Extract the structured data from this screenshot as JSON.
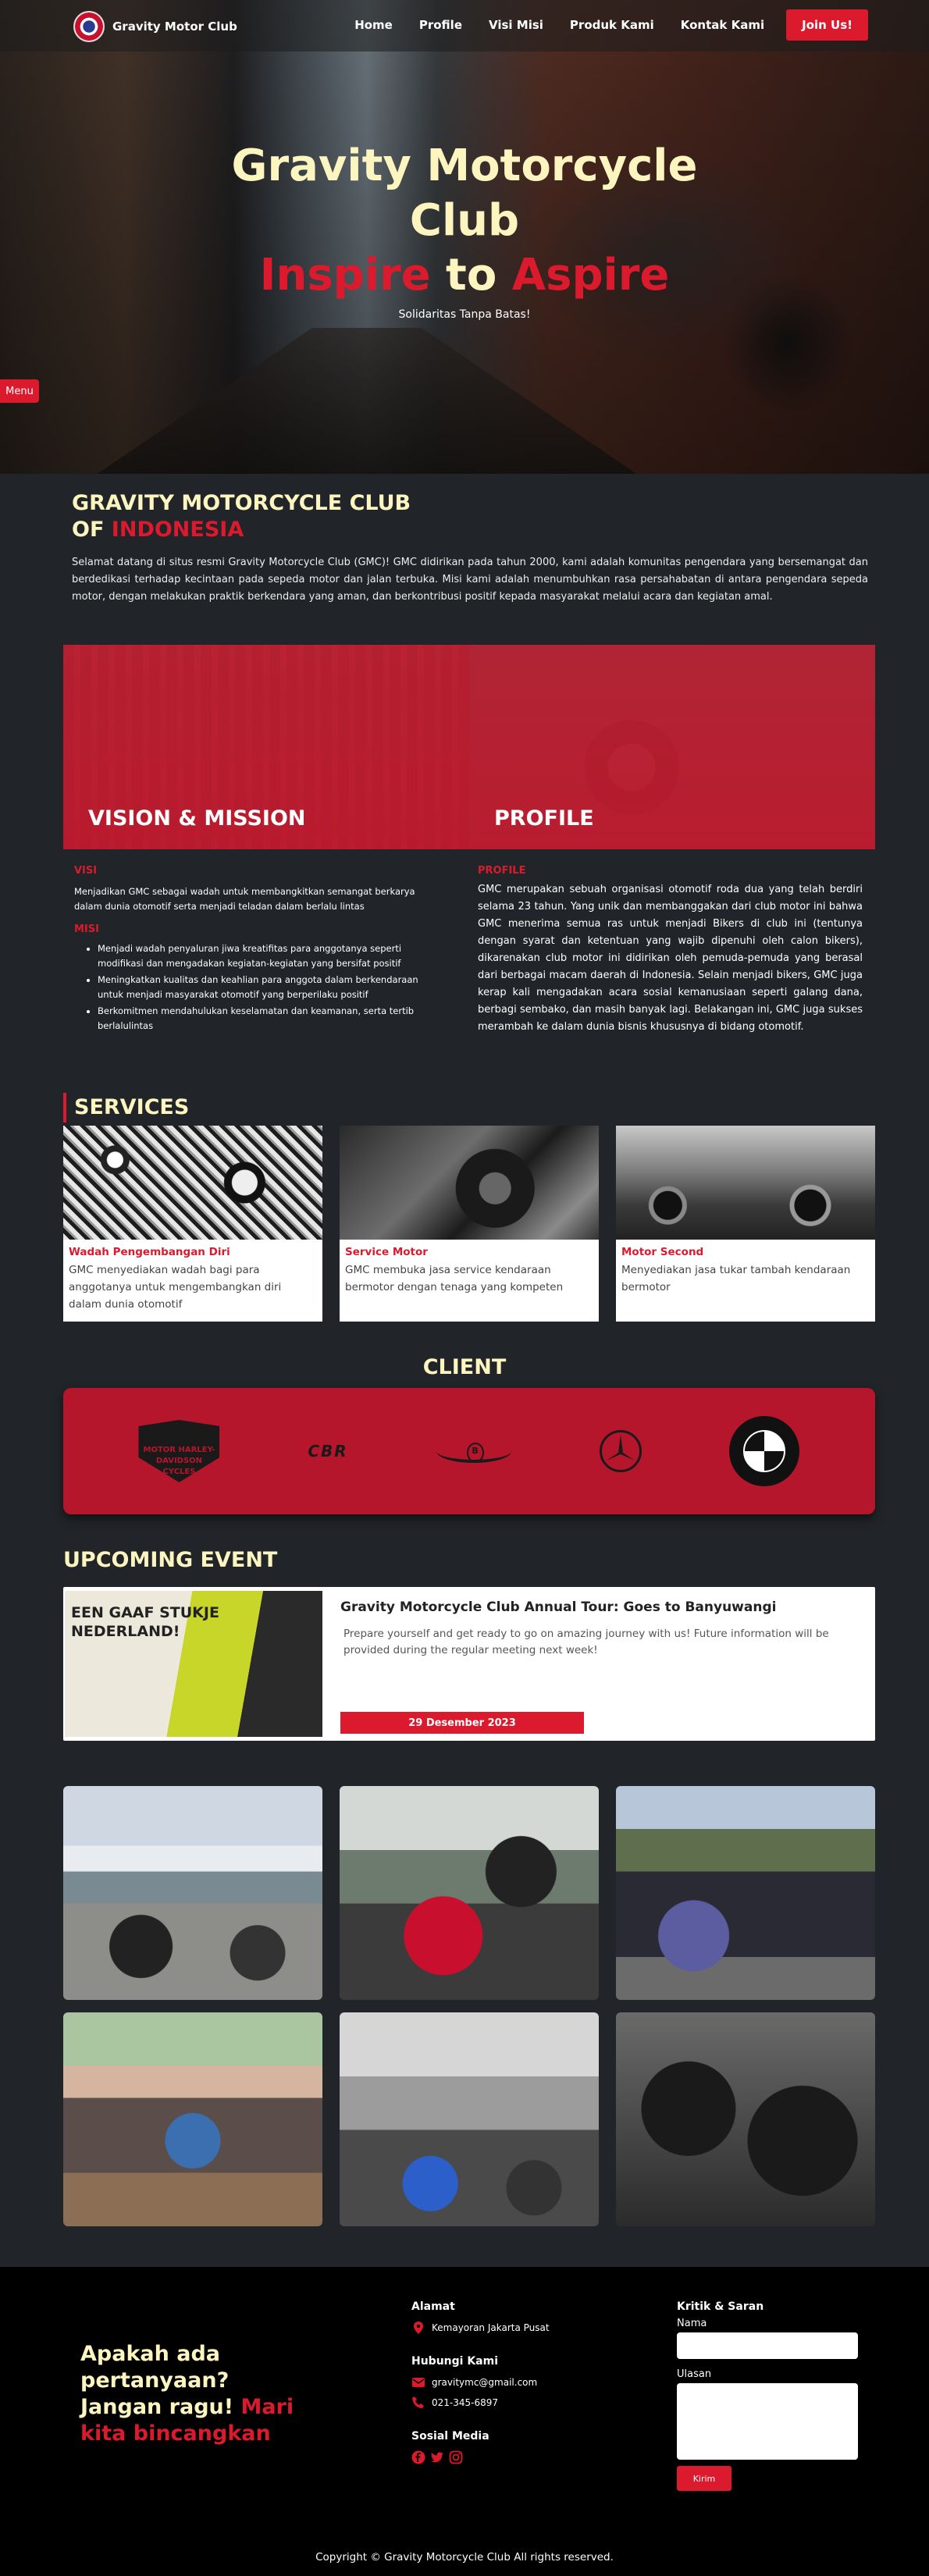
{
  "nav": {
    "brand": "Gravity Motor Club",
    "links": [
      "Home",
      "Profile",
      "Visi Misi",
      "Produk Kami",
      "Kontak Kami"
    ],
    "join": "Join Us!"
  },
  "hero": {
    "title_line1": "Gravity Motorcycle",
    "title_line2": "Club",
    "inspire": "Inspire",
    "to": " to ",
    "aspire": "Aspire",
    "subtitle": "Solidaritas Tanpa Batas!",
    "menu": "Menu"
  },
  "about": {
    "title_line1": "GRAVITY MOTORCYCLE CLUB",
    "title_of": "OF ",
    "title_country": "INDONESIA",
    "text": "Selamat datang di situs resmi Gravity Motorcycle Club (GMC)! GMC didirikan pada tahun 2000, kami adalah komunitas pengendara yang bersemangat dan berdedikasi terhadap kecintaan pada sepeda motor dan jalan terbuka. Misi kami adalah menumbuhkan rasa persahabatan di antara pengendara sepeda motor, dengan melakukan praktik berkendara yang aman, dan berkontribusi positif kepada masyarakat melalui acara dan kegiatan amal."
  },
  "vision": {
    "banner_left": "VISION & MISSION",
    "banner_right": "PROFILE",
    "visi_label": "VISI",
    "visi_text": "Menjadikan GMC sebagai wadah untuk membangkitkan semangat berkarya dalam dunia otomotif serta menjadi teladan dalam berlalu lintas",
    "misi_label": "MISI",
    "misi_items": [
      "Menjadi wadah penyaluran jiwa kreatifitas para anggotanya seperti modifikasi dan mengadakan kegiatan-kegiatan yang bersifat positif",
      "Meningkatkan kualitas dan keahlian para anggota dalam berkendaraan untuk menjadi masyarakat otomotif yang berperilaku positif",
      "Berkomitmen mendahulukan keselamatan dan keamanan, serta tertib berlalulintas"
    ],
    "profile_label": "PROFILE",
    "profile_text": "GMC merupakan sebuah organisasi otomotif roda dua yang telah berdiri selama 23 tahun. Yang unik dan membanggakan dari club motor ini bahwa GMC menerima semua ras untuk menjadi Bikers di club ini (tentunya dengan syarat dan ketentuan yang wajib dipenuhi oleh calon bikers), dikarenakan club motor ini didirikan oleh pemuda-pemuda yang berasal dari berbagai macam daerah di Indonesia. Selain menjadi bikers, GMC juga kerap kali mengadakan acara sosial kemanusiaan seperti galang dana, berbagi sembako, dan masih banyak lagi. Belakangan ini, GMC juga sukses merambah ke dalam dunia bisnis khususnya di bidang otomotif."
  },
  "services": {
    "title": "SERVICES",
    "items": [
      {
        "name": "Wadah Pengembangan Diri",
        "desc": "GMC menyediakan wadah bagi para anggotanya untuk mengembangkan diri dalam dunia otomotif"
      },
      {
        "name": "Service Motor",
        "desc": "GMC membuka jasa service kendaraan bermotor dengan tenaga yang kompeten"
      },
      {
        "name": "Motor Second",
        "desc": "Menyediakan jasa tukar tambah kendaraan bermotor"
      }
    ]
  },
  "client": {
    "title": "CLIENT",
    "hd_text": "MOTOR HARLEY-DAVIDSON CYCLES",
    "cbr_text": "CBR",
    "bmw_text": "B M W"
  },
  "event": {
    "title": "UPCOMING EVENT",
    "image_text": "EEN GAAF STUKJE NEDERLAND!",
    "name": "Gravity Motorcycle Club Annual Tour: Goes to Banyuwangi",
    "desc": "Prepare yourself and get ready to go on amazing journey with us! Future information will be provided during the regular meeting next week!",
    "date": "29 Desember 2023"
  },
  "footer": {
    "cta_line1": "Apakah ada pertanyaan?",
    "cta_line2": "Jangan ragu! ",
    "cta_red": "Mari kita bincangkan",
    "alamat_head": "Alamat",
    "alamat": "Kemayoran Jakarta Pusat",
    "hubungi_head": "Hubungi Kami",
    "email": "gravitymc@gmail.com",
    "phone": "021-345-6897",
    "sosial_head": "Sosial Media",
    "kritik_head": "Kritik & Saran",
    "nama_label": "Nama",
    "ulasan_label": "Ulasan",
    "send": "Kirim",
    "copyright": "Copyright © Gravity Motorcycle Club All rights reserved."
  },
  "colors": {
    "accent": "#dc1a2e",
    "heading": "#fdf5c0",
    "background": "#212529"
  }
}
